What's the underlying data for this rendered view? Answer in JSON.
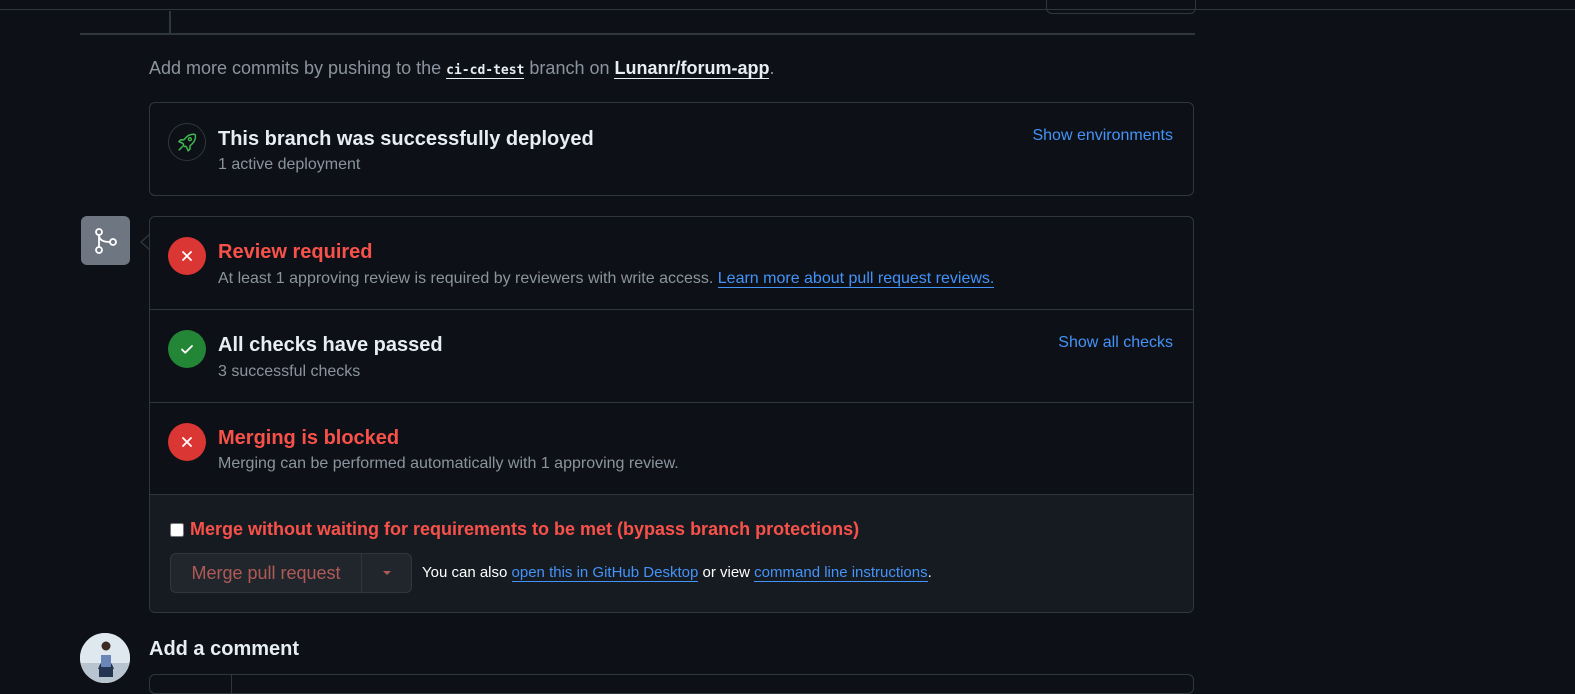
{
  "hint": {
    "prefix": "Add more commits by pushing to the ",
    "branch": "ci-cd-test",
    "middle": " branch on ",
    "repo": "Lunanr/forum-app",
    "suffix": "."
  },
  "deployment": {
    "title": "This branch was successfully deployed",
    "subtitle": "1 active deployment",
    "link": "Show environments",
    "icon": "rocket-icon"
  },
  "review": {
    "title": "Review required",
    "text": "At least 1 approving review is required by reviewers with write access. ",
    "link": "Learn more about pull request reviews.",
    "icon": "x-icon"
  },
  "checks": {
    "title": "All checks have passed",
    "subtitle": "3 successful checks",
    "link": "Show all checks",
    "icon": "check-icon"
  },
  "blocked": {
    "title": "Merging is blocked",
    "subtitle": "Merging can be performed automatically with 1 approving review.",
    "icon": "x-icon"
  },
  "merge": {
    "bypass_label": "Merge without waiting for requirements to be met (bypass branch protections)",
    "bypass_checked": false,
    "button_label": "Merge pull request",
    "also_prefix": "You can also ",
    "desktop_link": "open this in GitHub Desktop",
    "also_middle": " or view ",
    "cli_link": "command line instructions",
    "also_suffix": "."
  },
  "comment": {
    "title": "Add a comment"
  },
  "colors": {
    "background": "#0d1117",
    "border": "#30363d",
    "link": "#4493f8",
    "danger": "#f85149",
    "danger_fill": "#da3633",
    "success_fill": "#238636",
    "muted": "#8b949e"
  }
}
